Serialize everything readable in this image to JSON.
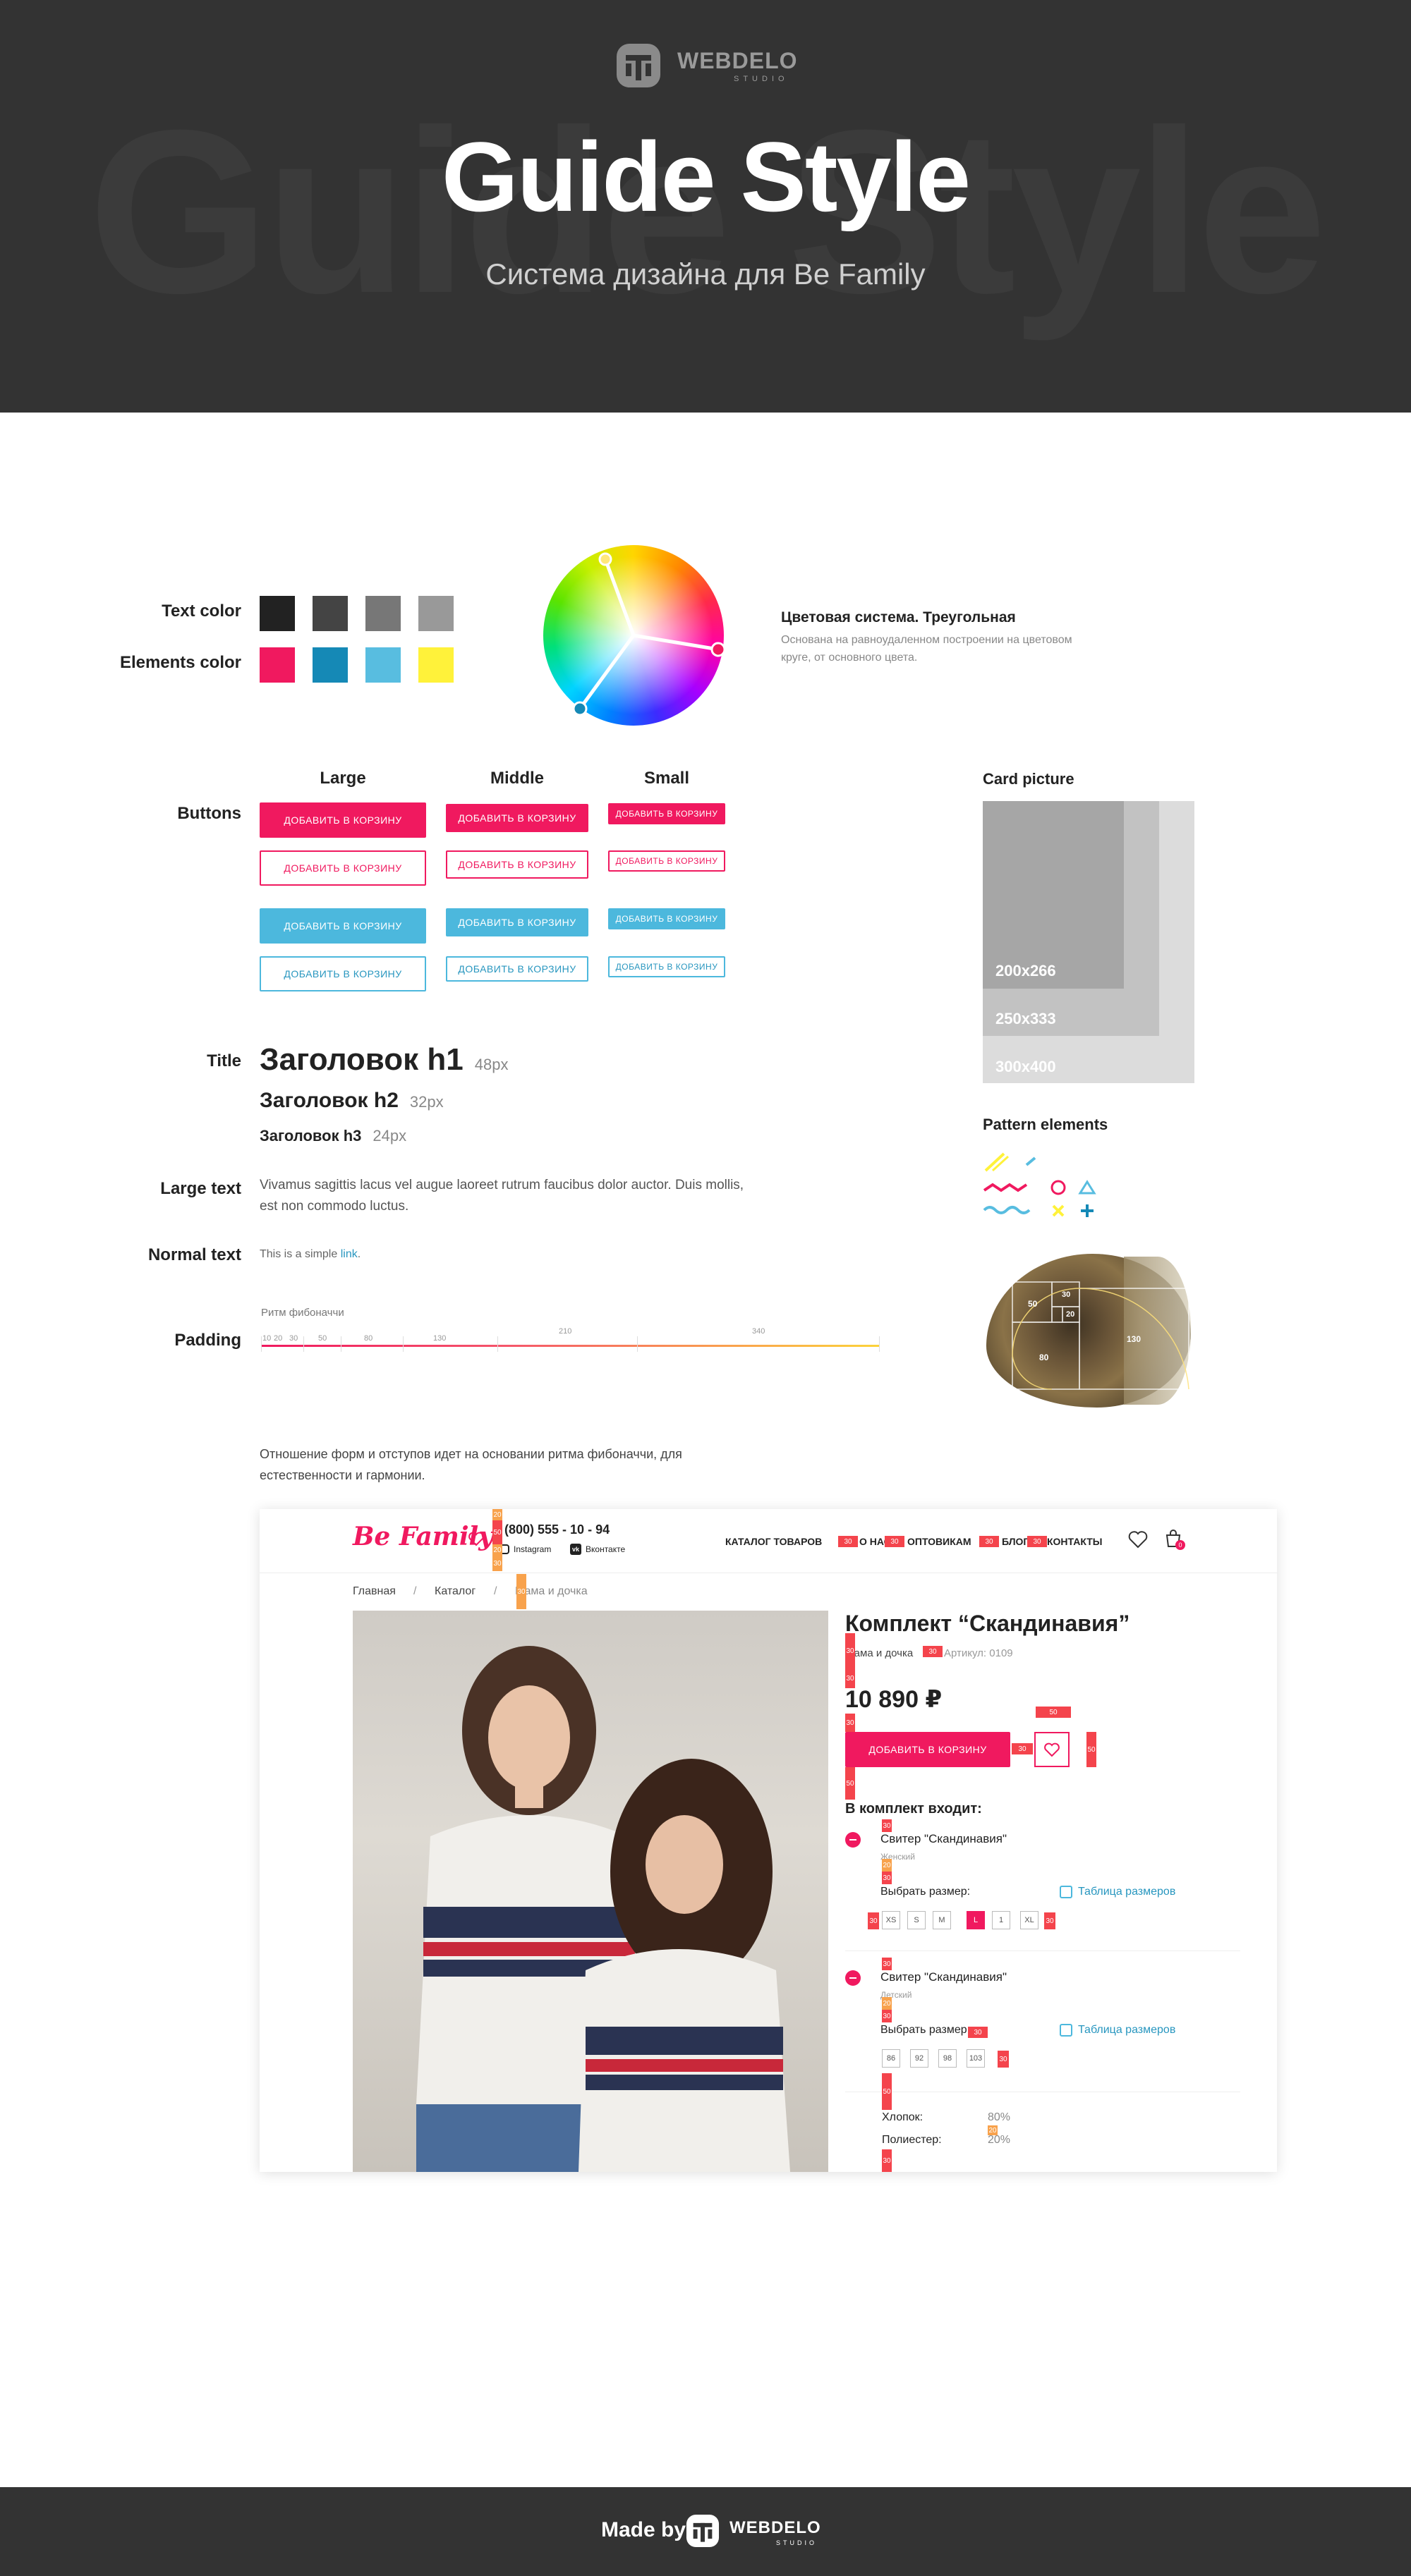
{
  "hero": {
    "bg_text": "Guide Style",
    "title": "Guide Style",
    "subtitle": "Система дизайна для Be Family",
    "logo_word": "WEBDELO",
    "logo_sub": "STUDIO"
  },
  "colors": {
    "text_label": "Text color",
    "elements_label": "Elements color",
    "text_colors": [
      "#222222",
      "#444444",
      "#777777",
      "#999999"
    ],
    "element_colors": [
      "#f0195f",
      "#1589b6",
      "#58bde0",
      "#fff23a"
    ]
  },
  "color_system": {
    "title": "Цветовая система. Треугольная",
    "desc_line1": "Основана на равноудаленном построении на цветовом",
    "desc_line2": "круге, от основного цвета."
  },
  "buttons": {
    "label": "Buttons",
    "col_large": "Large",
    "col_middle": "Middle",
    "col_small": "Small",
    "text": "ДОБАВИТЬ В КОРЗИНУ"
  },
  "card": {
    "title": "Card picture",
    "s1": "200x266",
    "s2": "250x333",
    "s3": "300x400"
  },
  "typography": {
    "title_label": "Title",
    "h1": "Заголовок h1",
    "h1_px": "48px",
    "h2": "Заголовок h2",
    "h2_px": "32px",
    "h3": "Заголовок h3",
    "h3_px": "24px",
    "large_label": "Large text",
    "large_line1": "Vivamus sagittis lacus vel augue laoreet rutrum faucibus dolor auctor. Duis mollis,",
    "large_line2": "est non commodo luctus.",
    "normal_label": "Normal text",
    "normal_text": "This is a simple ",
    "normal_link": "link",
    "normal_end": "."
  },
  "padding": {
    "label": "Padding",
    "title": "Ритм фибоначчи",
    "nums": [
      "10",
      "20",
      "30",
      "50",
      "80",
      "130",
      "210",
      "340"
    ]
  },
  "pattern": {
    "title": "Pattern elements"
  },
  "shell": {
    "n50": "50",
    "n30": "30",
    "n20": "20",
    "n80": "80",
    "n130": "130"
  },
  "fib_text": {
    "line1": "Отношение форм и отступов идет на основании ритма фибоначчи, для",
    "line2": "естественности и гармонии."
  },
  "mockup": {
    "logo": "Be Family",
    "phone": "(800) 555 - 10 - 94",
    "instagram": "Instagram",
    "vk": "Вконтакте",
    "nav": [
      "КАТАЛОГ ТОВАРОВ",
      "О НАС",
      "ОПТОВИКАМ",
      "БЛОГ",
      "КОНТАКТЫ"
    ],
    "cart_count": "0",
    "breadcrumb": [
      "Главная",
      "/",
      "Каталог",
      "/",
      "Мама и дочка"
    ],
    "title": "Комплект “Скандинавия”",
    "category": "Мама и дочка",
    "article": "Артикул: 0109",
    "price": "10 890 ₽",
    "add_button": "ДОБАВИТЬ В КОРЗИНУ",
    "set_title": "В комплект входит:",
    "item1_name": "Свитер \"Скандинавия\"",
    "item1_sub": "Женский",
    "item2_name": "Свитер \"Скандинавия\"",
    "item2_sub": "Детский",
    "choose_size": "Выбрать размер:",
    "size_table": "Таблица размеров",
    "sizes1": [
      "XS",
      "S",
      "M",
      "L",
      "1",
      "XL"
    ],
    "sizes2": [
      "86",
      "92",
      "98",
      "103"
    ],
    "cotton": "Хлопок:",
    "cotton_val": "80%",
    "poly": "Полиестер:",
    "poly_val": "20%",
    "tags": {
      "t50": "50",
      "t30": "30",
      "t20": "20"
    }
  },
  "footer": {
    "made_by": "Made by",
    "logo_word": "WEBDELO",
    "logo_sub": "STUDIO"
  }
}
